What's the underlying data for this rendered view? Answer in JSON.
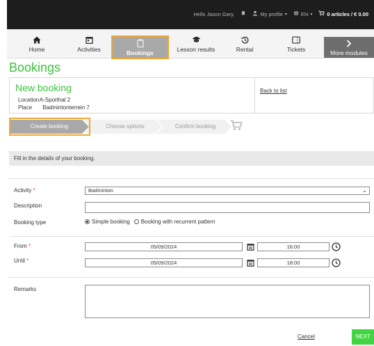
{
  "topbar": {
    "greeting": "Hello Jason Gary,",
    "profile_label": "My profile",
    "language": "EN",
    "cart_summary": "0 articles / € 0.00"
  },
  "modules": [
    {
      "label": "Home",
      "icon": "home-icon"
    },
    {
      "label": "Activities",
      "icon": "calendar-icon"
    },
    {
      "label": "Bookings",
      "icon": "clipboard-icon",
      "active": true
    },
    {
      "label": "Lesson results",
      "icon": "graduation-cap-icon"
    },
    {
      "label": "Rental",
      "icon": "history-icon"
    },
    {
      "label": "Tickets",
      "icon": "ticket-icon"
    },
    {
      "label": "More modules",
      "icon": "chevron-right-icon"
    }
  ],
  "page_title": "Bookings",
  "booking_info": {
    "title": "New booking",
    "location_label": "Location",
    "location_value": "A-Sporthal 2",
    "place_label": "Place",
    "place_value": "Badmintonterrein 7",
    "back_link": "Back to list"
  },
  "steps": [
    "Create booking",
    "Choose options",
    "Confirm booking"
  ],
  "hint": "Fill in the details of your booking.",
  "form": {
    "activity_label": "Activity",
    "activity_value": "Badminton",
    "description_label": "Description",
    "description_value": "",
    "booking_type_label": "Booking type",
    "booking_type_options": [
      "Simple booking",
      "Booking with recurrent pattern"
    ],
    "booking_type_selected": "Simple booking",
    "from_label": "From",
    "from_date": "05/09/2024",
    "from_time": "16:00",
    "until_label": "Until",
    "until_date": "05/09/2024",
    "until_time": "18:00",
    "remarks_label": "Remarks",
    "remarks_value": "",
    "required_mark": "*"
  },
  "actions": {
    "cancel": "Cancel",
    "next": "NEXT"
  },
  "colors": {
    "accent_green": "#3cc33c",
    "next_button": "#41d641",
    "highlight_outline": "#f0a830",
    "required": "#e53935"
  }
}
